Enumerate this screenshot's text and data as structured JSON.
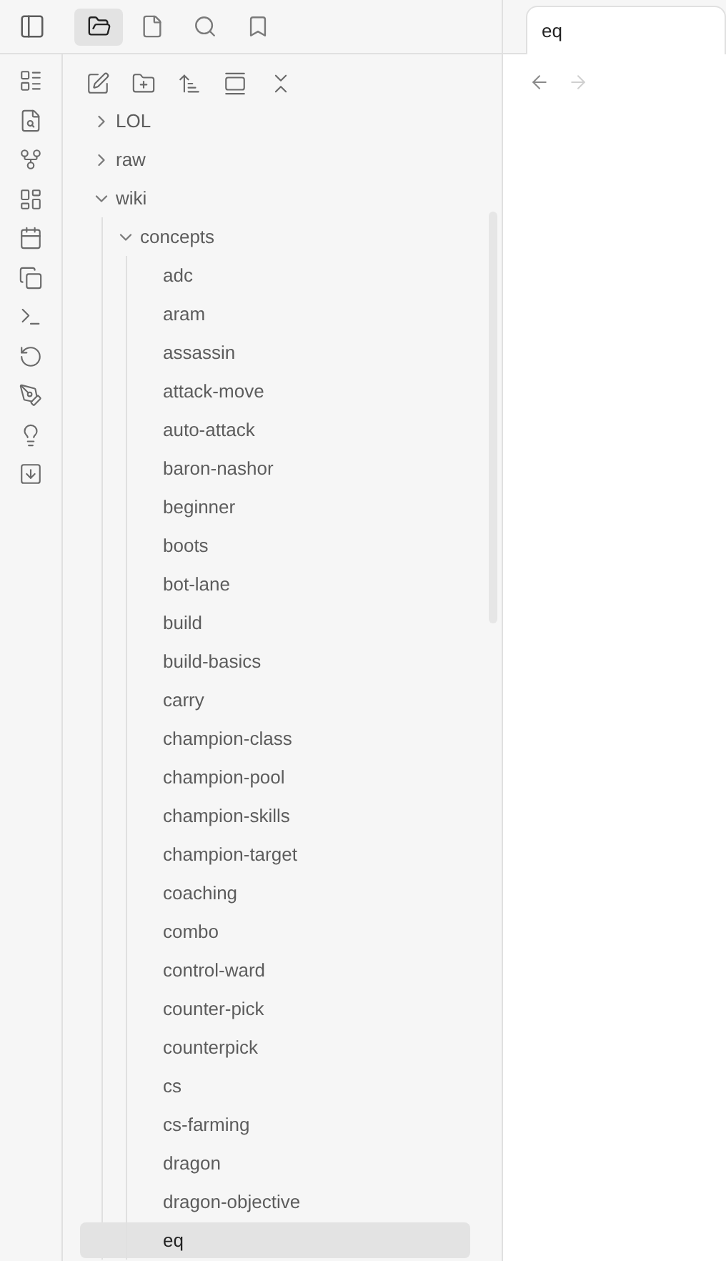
{
  "sidebar_tabs": [
    {
      "kind": "files",
      "selected": true
    },
    {
      "kind": "file",
      "selected": false
    },
    {
      "kind": "search",
      "selected": false
    },
    {
      "kind": "bookmarks",
      "selected": false
    }
  ],
  "tree": [
    {
      "kind": "folder",
      "name": "LOL",
      "expanded": false
    },
    {
      "kind": "folder",
      "name": "raw",
      "expanded": false
    },
    {
      "kind": "folder",
      "name": "wiki",
      "expanded": true,
      "children": [
        {
          "kind": "folder",
          "name": "concepts",
          "expanded": true,
          "children": [
            {
              "kind": "file",
              "name": "adc",
              "selected": false
            },
            {
              "kind": "file",
              "name": "aram",
              "selected": false
            },
            {
              "kind": "file",
              "name": "assassin",
              "selected": false
            },
            {
              "kind": "file",
              "name": "attack-move",
              "selected": false
            },
            {
              "kind": "file",
              "name": "auto-attack",
              "selected": false
            },
            {
              "kind": "file",
              "name": "baron-nashor",
              "selected": false
            },
            {
              "kind": "file",
              "name": "beginner",
              "selected": false
            },
            {
              "kind": "file",
              "name": "boots",
              "selected": false
            },
            {
              "kind": "file",
              "name": "bot-lane",
              "selected": false
            },
            {
              "kind": "file",
              "name": "build",
              "selected": false
            },
            {
              "kind": "file",
              "name": "build-basics",
              "selected": false
            },
            {
              "kind": "file",
              "name": "carry",
              "selected": false
            },
            {
              "kind": "file",
              "name": "champion-class",
              "selected": false
            },
            {
              "kind": "file",
              "name": "champion-pool",
              "selected": false
            },
            {
              "kind": "file",
              "name": "champion-skills",
              "selected": false
            },
            {
              "kind": "file",
              "name": "champion-target",
              "selected": false
            },
            {
              "kind": "file",
              "name": "coaching",
              "selected": false
            },
            {
              "kind": "file",
              "name": "combo",
              "selected": false
            },
            {
              "kind": "file",
              "name": "control-ward",
              "selected": false
            },
            {
              "kind": "file",
              "name": "counter-pick",
              "selected": false
            },
            {
              "kind": "file",
              "name": "counterpick",
              "selected": false
            },
            {
              "kind": "file",
              "name": "cs",
              "selected": false
            },
            {
              "kind": "file",
              "name": "cs-farming",
              "selected": false
            },
            {
              "kind": "file",
              "name": "dragon",
              "selected": false
            },
            {
              "kind": "file",
              "name": "dragon-objective",
              "selected": false
            },
            {
              "kind": "file",
              "name": "eq",
              "selected": true
            }
          ]
        }
      ]
    }
  ],
  "editor_tab": {
    "title": "eq"
  },
  "nav": [
    {
      "kind": "back",
      "disabled": false
    },
    {
      "kind": "forward",
      "disabled": true
    }
  ]
}
